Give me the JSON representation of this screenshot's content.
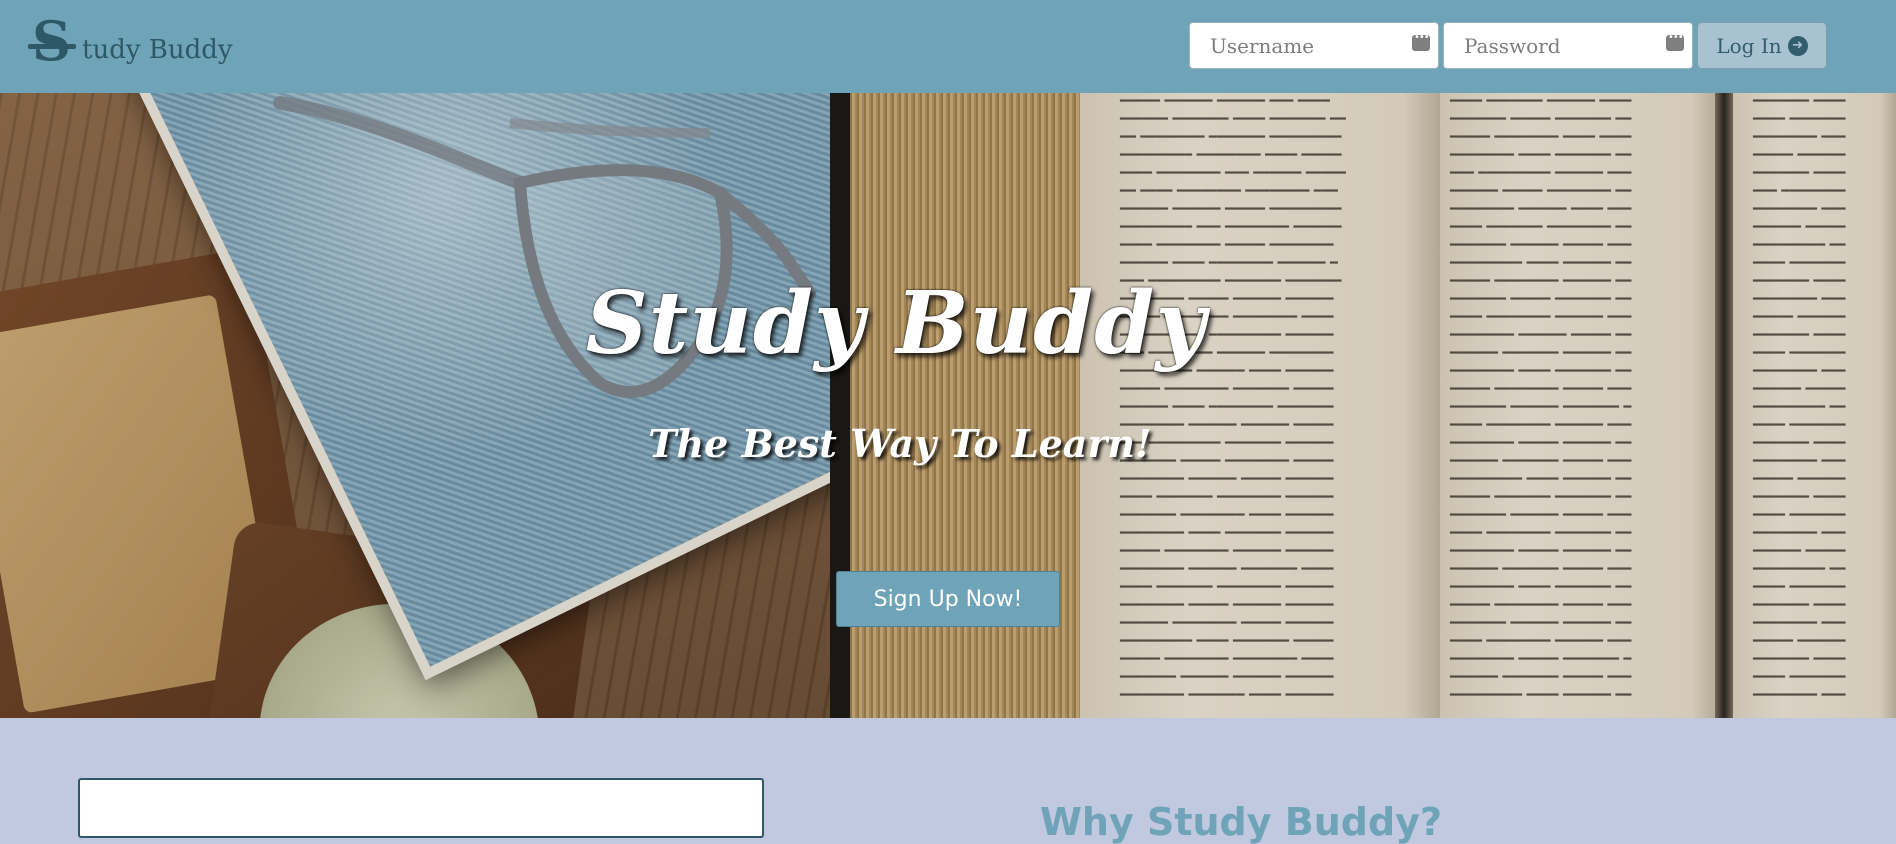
{
  "brand": {
    "name": "tudy Buddy",
    "mark": "S"
  },
  "login": {
    "username_placeholder": "Username",
    "password_placeholder": "Password",
    "button_label": "Log In"
  },
  "hero": {
    "title": "Study Buddy",
    "subtitle": "The Best Way To Learn!",
    "cta_label": "Sign Up Now!"
  },
  "lower": {
    "section_title": "Why Study Buddy?"
  },
  "colors": {
    "navbar": "#6fa3b8",
    "brand_text": "#2e5866",
    "login_button": "#a9c2d1",
    "cta_button": "#6fa3b8",
    "page_background": "#c0c9df"
  },
  "icons": {
    "login_button_icon": "arrow-circle-right-icon",
    "field_icon": "password-manager-icon"
  }
}
